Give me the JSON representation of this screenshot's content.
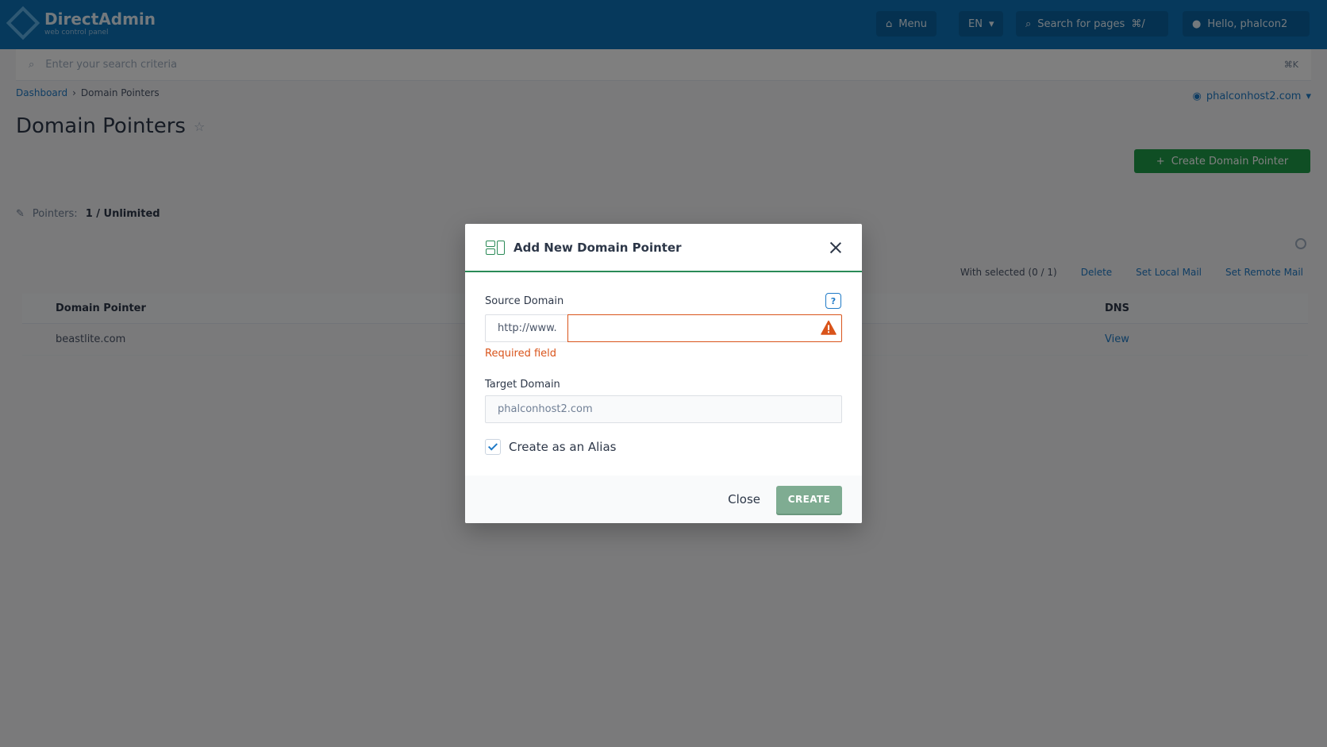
{
  "app": {
    "logo_text": "DirectAdmin",
    "logo_sub": "web control panel",
    "menu_label": "Menu",
    "lang_label": "EN",
    "search_pages_label": "Search for pages",
    "search_pages_kbd": "⌘/",
    "user_label": "Hello, phalcon2"
  },
  "search": {
    "placeholder": "Enter your search criteria",
    "kbd": "⌘K"
  },
  "breadcrumb": {
    "home": "Dashboard",
    "separator": "›",
    "current": "Domain Pointers"
  },
  "user_domain": "phalconhost2.com",
  "page": {
    "title": "Domain Pointers",
    "create_button": "Create Domain Pointer"
  },
  "summary": {
    "label": "Pointers:",
    "value": "1 / Unlimited"
  },
  "bulk": {
    "with_selected": "With selected (0 / 1)",
    "delete": "Delete",
    "set_local_mail": "Set Local Mail",
    "set_remote_mail": "Set Remote Mail"
  },
  "table": {
    "headers": [
      "Domain Pointer",
      "DNS"
    ],
    "rows": [
      {
        "domain": "beastlite.com",
        "dns": "View"
      }
    ]
  },
  "modal": {
    "title": "Add New Domain Pointer",
    "source_label": "Source Domain",
    "help_symbol": "?",
    "prefix": "http://www.",
    "source_value": "",
    "error": "Required field",
    "target_label": "Target Domain",
    "target_placeholder": "phalconhost2.com",
    "alias_label": "Create as an Alias",
    "alias_checked": true,
    "close_label": "Close",
    "create_label": "CREATE"
  },
  "colors": {
    "brand_blue": "#0d73b8",
    "accent_green": "#2a8a57",
    "error_orange": "#d9541b",
    "create_disabled": "#7fac92"
  }
}
